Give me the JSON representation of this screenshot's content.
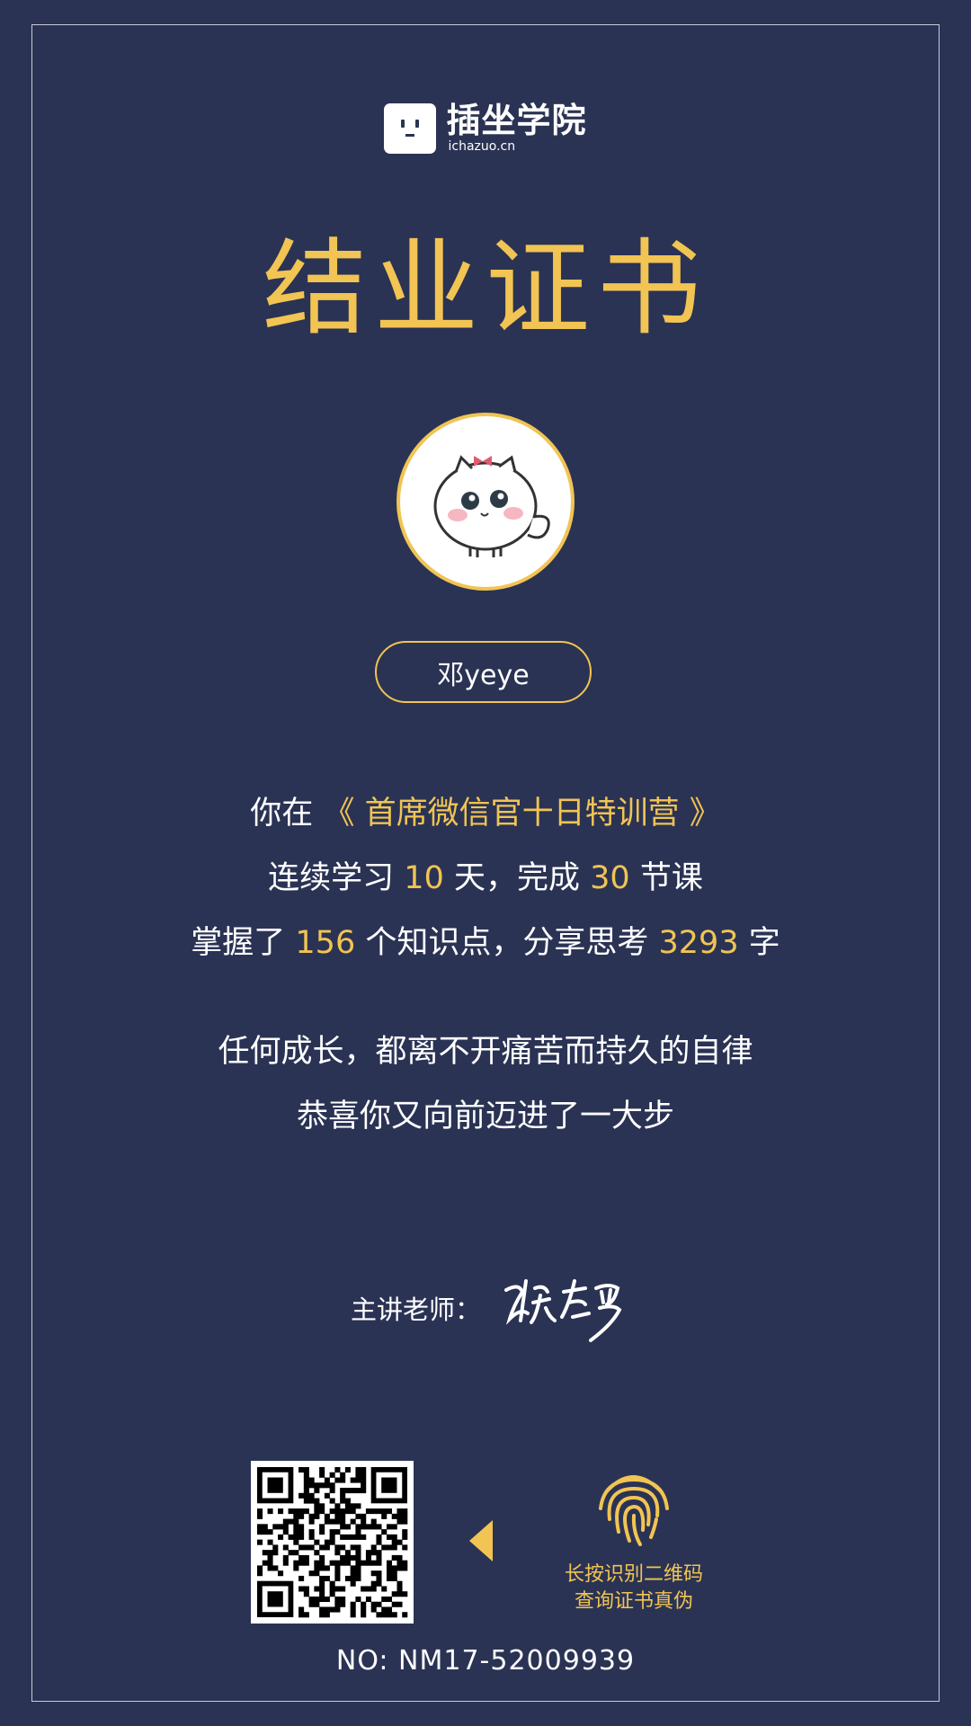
{
  "brand": {
    "name": "插坐学院",
    "url": "ichazuo.cn"
  },
  "certificate": {
    "title": "结业证书",
    "student_name": "邓yeye"
  },
  "summary": {
    "line1": {
      "prefix": "你在",
      "course": "《 首席微信官十日特训营 》"
    },
    "line2": {
      "p1": "连续学习",
      "days": "10",
      "p2": "天，完成",
      "lessons": "30",
      "p3": "节课"
    },
    "line3": {
      "p1": "掌握了",
      "points": "156",
      "p2": "个知识点，分享思考",
      "words": "3293",
      "p3": "字"
    },
    "motto1": "任何成长，都离不开痛苦而持久的自律",
    "motto2": "恭喜你又向前迈进了一大步"
  },
  "teacher": {
    "label": "主讲老师：",
    "signature": "张左罗"
  },
  "verify": {
    "hint_line1": "长按识别二维码",
    "hint_line2": "查询证书真伪"
  },
  "certificate_no": "NO: NM17-52009939",
  "colors": {
    "background": "#2b3354",
    "accent": "#f1c453",
    "text": "#ffffff"
  }
}
